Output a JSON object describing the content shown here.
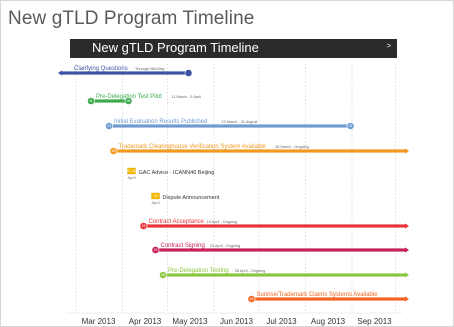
{
  "slide": {
    "title": "New gTLD Program Timeline",
    "banner_title": "New gTLD Program Timeline",
    "banner_arrow": ">"
  },
  "timeline": {
    "months": [
      "Mar 2013",
      "Apr 2013",
      "May 2013",
      "Jun 2013",
      "Jul 2013",
      "Aug 2013",
      "Sep 2013"
    ],
    "tasks": [
      {
        "label": "Clarifying Questions",
        "dates": "Through Mid May",
        "start": "",
        "end": "",
        "color": "#3d52a3",
        "start_day": "2013-02-27",
        "end_day": "2013-05-15",
        "left_open": true,
        "right_open": false
      },
      {
        "label": "Pre-Delegation Test Pilot",
        "dates": "11 March - 5 April",
        "start": "11",
        "end": "05",
        "color": "#3daa4b",
        "start_day": "2013-03-11",
        "end_day": "2013-04-05",
        "left_open": false,
        "right_open": false
      },
      {
        "label": "Initial Evaluation Results Published",
        "dates": "23 March - 31 August",
        "start": "23",
        "end": "31",
        "color": "#6f9bd0",
        "start_day": "2013-03-23",
        "end_day": "2013-08-31",
        "left_open": false,
        "right_open": false
      },
      {
        "label": "Trademark Clearinghouse Verification System Available",
        "dates": "26 March - Ongoing",
        "start": "26",
        "end": "",
        "color": "#f39a1e",
        "start_day": "2013-03-26",
        "end_day": "2013-09-30",
        "left_open": false,
        "right_open": true
      },
      {
        "label": "Contract Acceptance",
        "dates": "15 April - Ongoing",
        "start": "15",
        "end": "",
        "color": "#e8323c",
        "start_day": "2013-04-15",
        "end_day": "2013-09-30",
        "left_open": false,
        "right_open": true
      },
      {
        "label": "Contract Signing",
        "dates": "23 April - Ongoing",
        "start": "23",
        "end": "",
        "color": "#c81e5a",
        "start_day": "2013-04-23",
        "end_day": "2013-09-30",
        "left_open": false,
        "right_open": true
      },
      {
        "label": "Pre-Delegation Testing",
        "dates": "28 April - Ongoing",
        "start": "28",
        "end": "",
        "color": "#8cc63f",
        "start_day": "2013-04-28",
        "end_day": "2013-09-30",
        "left_open": false,
        "right_open": true
      },
      {
        "label": "Sunrise/Trademark Claims Systems Available",
        "dates": "",
        "start": "26",
        "end": "",
        "color": "#f26522",
        "start_day": "2013-06-26",
        "end_day": "2013-09-30",
        "left_open": false,
        "right_open": true
      }
    ],
    "milestones": [
      {
        "label": "GAC Advice - ICANN46 Beijing",
        "date_num": "07-11",
        "month": "April",
        "day": "2013-04-07"
      },
      {
        "label": "Dispute Announcement",
        "date_num": "23",
        "month": "April",
        "day": "2013-04-23"
      }
    ]
  }
}
